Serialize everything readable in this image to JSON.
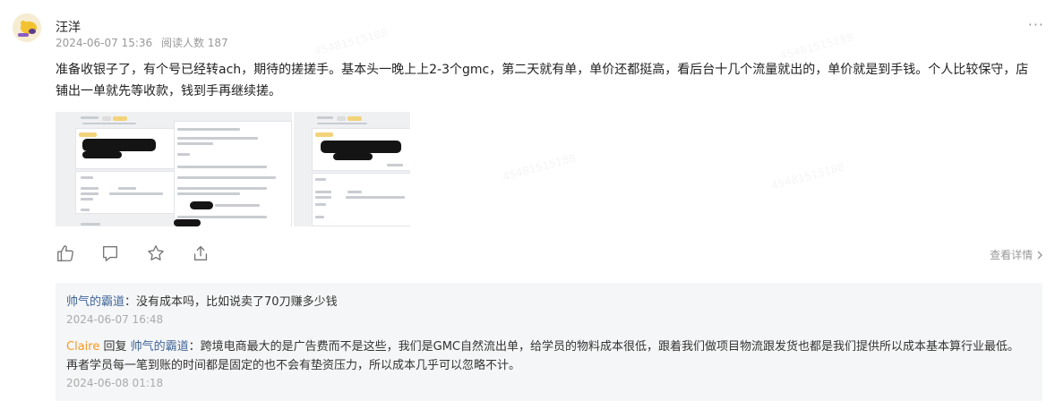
{
  "post": {
    "author": "汪洋",
    "date": "2024-06-07 15:36",
    "views": "阅读人数 187",
    "content": "准备收银子了，有个号已经转ach，期待的搓搓手。基本头一晚上上2-3个gmc，第二天就有单，单价还都挺高，看后台十几个流量就出的，单价就是到手钱。个人比较保守，店铺出一单就先等收款，钱到手再继续搓。",
    "detail_link": "查看详情",
    "more_icon": "···"
  },
  "comments": [
    {
      "author": "帅气的霸道",
      "separator": "：",
      "text": "没有成本吗，比如说卖了70刀赚多少钱",
      "time": "2024-06-07 16:48"
    },
    {
      "author": "Claire",
      "reply_word": " 回复 ",
      "reply_to": "帅气的霸道",
      "separator": "：",
      "text": "跨境电商最大的是广告费而不是这些，我们是GMC自然流出单，给学员的物料成本很低，跟着我们做项目物流跟发货也都是我们提供所以成本基本算行业最低。再者学员每一笔到账的时间都是固定的也不会有垫资压力，所以成本几乎可以忽略不计。",
      "time": "2024-06-08 01:18"
    }
  ],
  "icons": {
    "like": "thumbs-up-icon",
    "comment": "comment-icon",
    "favorite": "star-icon",
    "share": "share-icon",
    "detail": "chevron-right-icon"
  },
  "colors": {
    "link_blue": "#406599",
    "claire_orange": "#f59a23",
    "meta_gray": "#999999",
    "comment_bg": "#f5f6f7"
  }
}
